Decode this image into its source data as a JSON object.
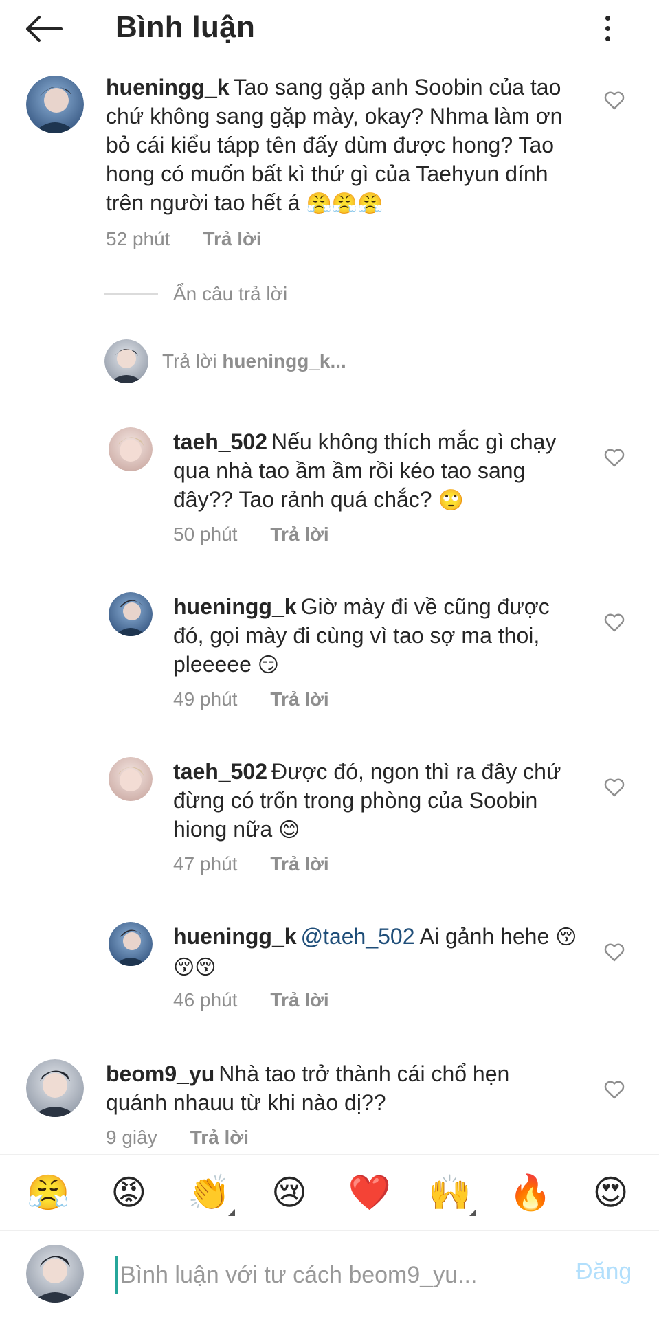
{
  "header": {
    "title": "Bình luận"
  },
  "comments": [
    {
      "username": "hueningg_k",
      "text": "Tao sang gặp anh Soobin của tao chứ không sang gặp mày, okay? Nhma làm ơn bỏ cái kiểu tápp tên đấy dùm được hong? Tao hong có muốn bất kì thứ gì của Taehyun dính trên người tao hết á",
      "emojis": "😤😤😤",
      "time": "52 phút",
      "reply": "Trả lời"
    }
  ],
  "thread": {
    "hide_replies": "Ẩn câu trả lời",
    "reply_prefix": "Trả lời",
    "reply_target": "hueningg_k..."
  },
  "replies": [
    {
      "username": "taeh_502",
      "text": "Nếu không thích mắc gì chạy qua nhà tao ầm ầm rồi kéo tao sang đây?? Tao rảnh quá chắc?",
      "emojis": "🙄",
      "time": "50 phút",
      "reply": "Trả lời"
    },
    {
      "username": "hueningg_k",
      "text": "Giờ mày đi về cũng được đó, gọi mày đi cùng vì tao sợ ma thoi, pleeeee",
      "emojis": "😏",
      "time": "49 phút",
      "reply": "Trả lời"
    },
    {
      "username": "taeh_502",
      "text": "Được đó, ngon thì ra đây chứ đừng có trốn trong phòng của Soobin hiong nữa",
      "emojis": "😊",
      "time": "47 phút",
      "reply": "Trả lời"
    },
    {
      "username": "hueningg_k",
      "mention": "@taeh_502",
      "text": "Ai gảnh hehe",
      "emojis": "😚😚😚",
      "time": "46 phút",
      "reply": "Trả lời"
    }
  ],
  "last_comment": {
    "username": "beom9_yu",
    "text": "Nhà tao trở thành cái chổ hẹn quánh nhauu từ khi nào dị??",
    "time": "9 giây",
    "reply": "Trả lời"
  },
  "emoji_bar": [
    "😤",
    "😡",
    "👏",
    "😢",
    "❤️",
    "🙌",
    "🔥",
    "😍"
  ],
  "composer": {
    "placeholder": "Bình luận với tư cách beom9_yu...",
    "post_label": "Đăng"
  },
  "icons": {
    "back": "arrow-left-icon",
    "more": "more-vertical-icon",
    "like": "heart-outline-icon"
  },
  "colors": {
    "text": "#262626",
    "muted": "#8e8e8e",
    "mention": "#1f4e79",
    "post_disabled": "#b2dffc"
  }
}
